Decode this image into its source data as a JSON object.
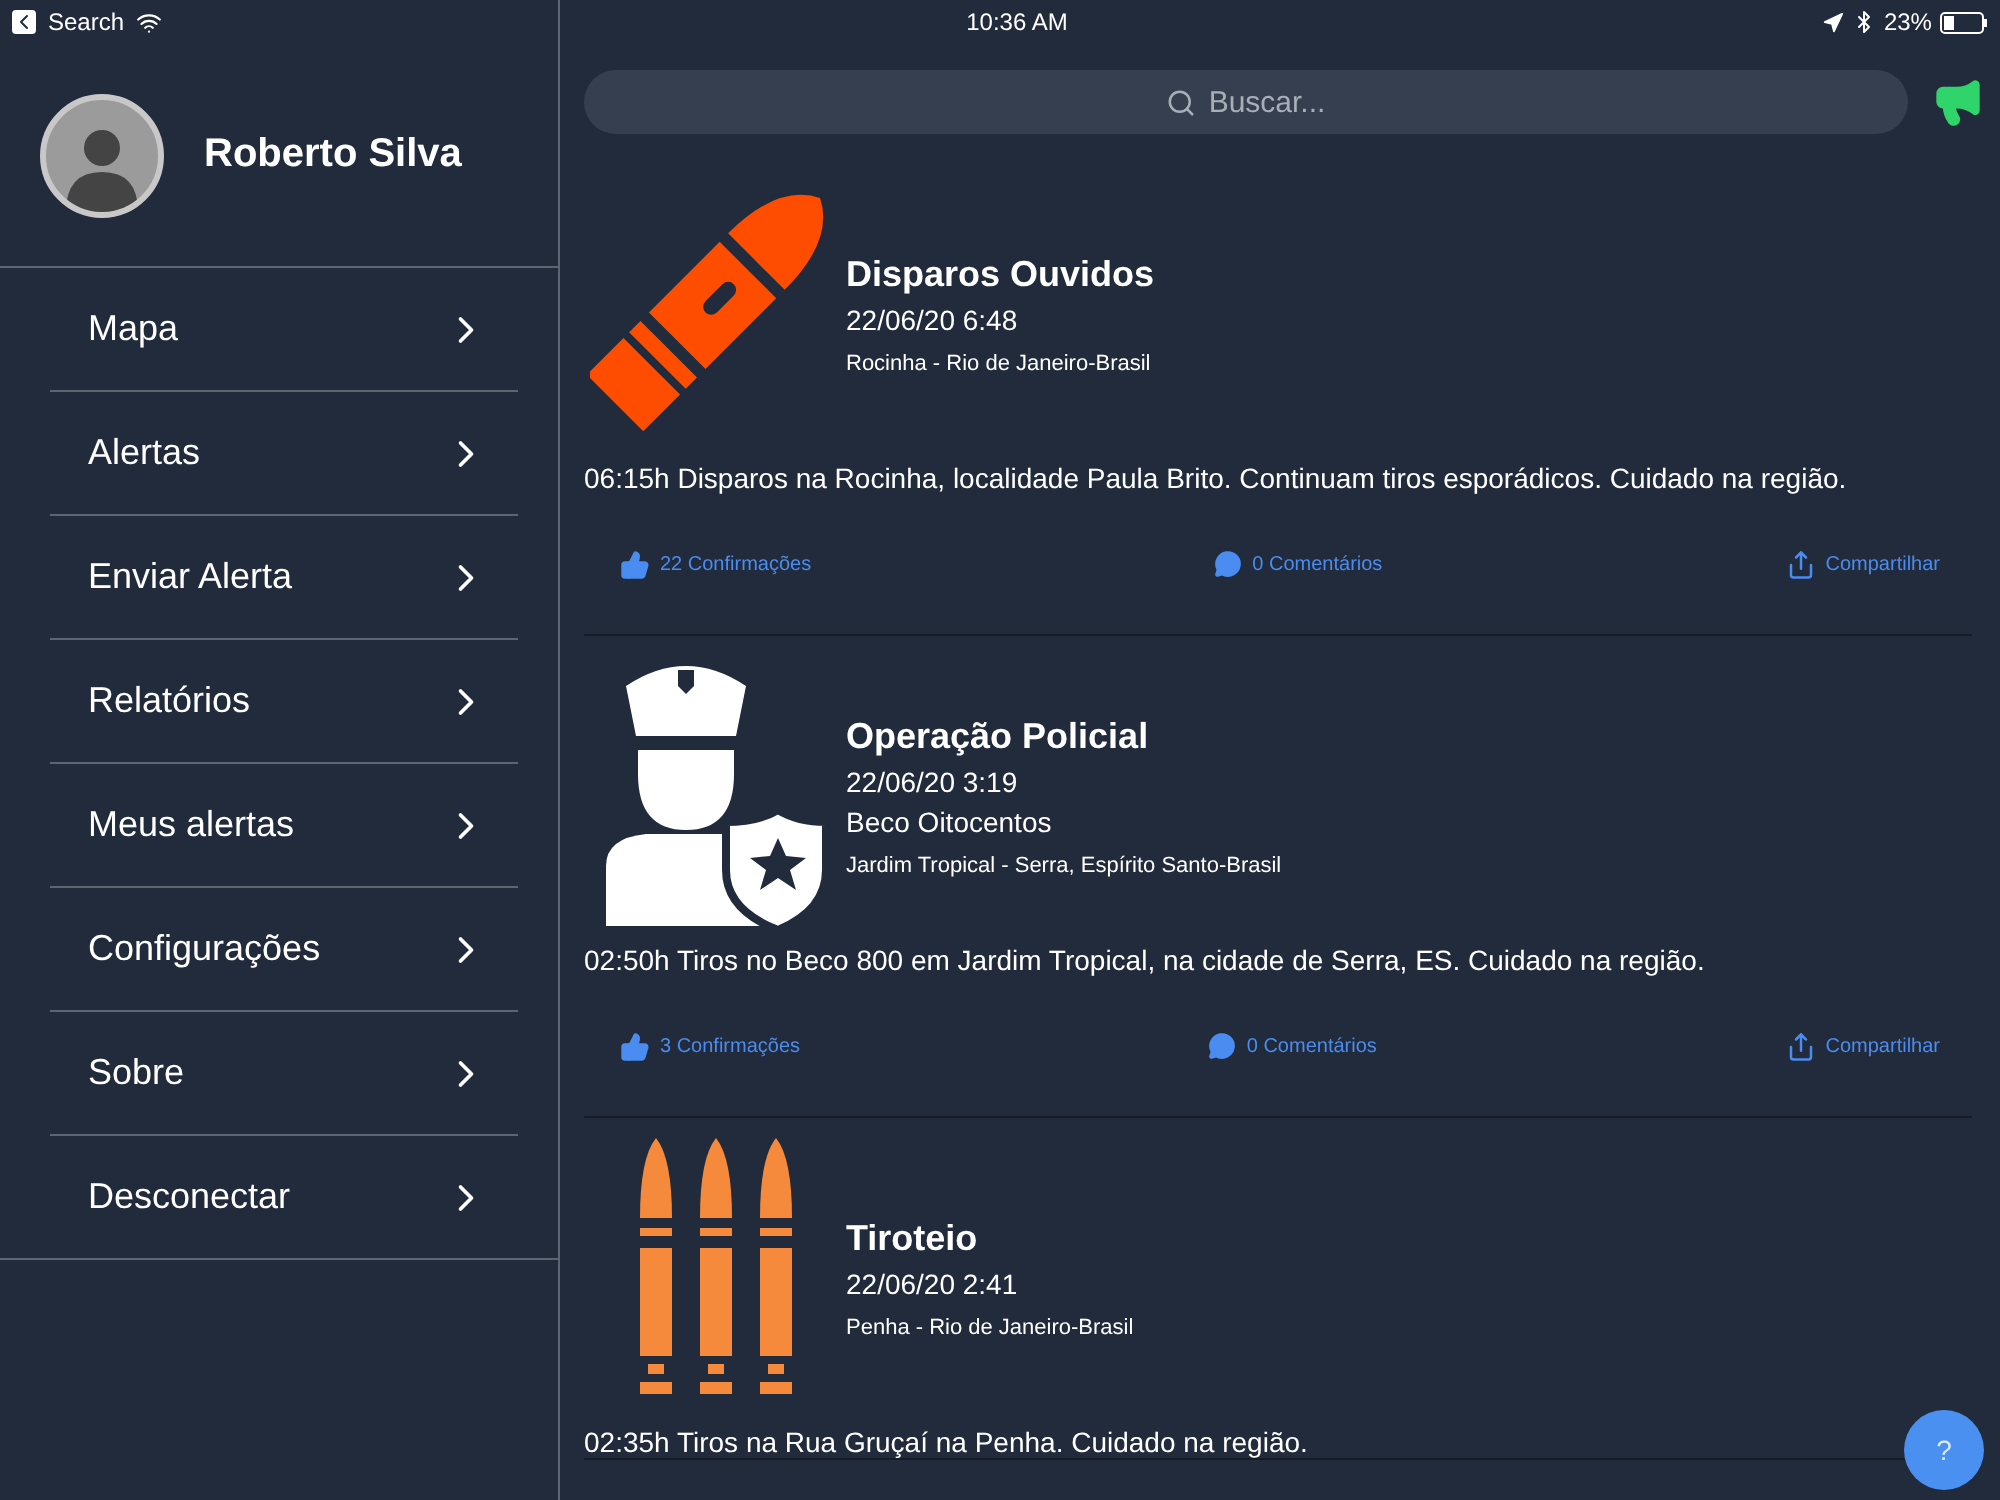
{
  "status_bar": {
    "back_label": "Search",
    "time": "10:36 AM",
    "battery": "23%"
  },
  "profile": {
    "name": "Roberto Silva"
  },
  "menu": [
    {
      "label": "Mapa"
    },
    {
      "label": "Alertas"
    },
    {
      "label": "Enviar Alerta"
    },
    {
      "label": "Relatórios"
    },
    {
      "label": "Meus alertas"
    },
    {
      "label": "Configurações"
    },
    {
      "label": "Sobre"
    },
    {
      "label": "Desconectar"
    }
  ],
  "search": {
    "placeholder": "Buscar..."
  },
  "alerts": [
    {
      "kind": "bullet",
      "title": "Disparos Ouvidos",
      "date": "22/06/20 6:48",
      "location": "Rocinha - Rio de Janeiro-Brasil",
      "description": "06:15h Disparos na Rocinha, localidade Paula Brito. Continuam tiros esporádicos. Cuidado na região.",
      "confirmations": "22 Confirmações",
      "comments": "0 Comentários",
      "share": "Compartilhar"
    },
    {
      "kind": "police",
      "title": "Operação Policial",
      "date": "22/06/20 3:19",
      "place": "Beco Oitocentos",
      "location": "Jardim Tropical - Serra, Espírito Santo-Brasil",
      "description": "02:50h Tiros no Beco 800 em Jardim Tropical, na cidade de Serra, ES. Cuidado na região.",
      "confirmations": "3 Confirmações",
      "comments": "0 Comentários",
      "share": "Compartilhar"
    },
    {
      "kind": "bullets",
      "title": "Tiroteio",
      "date": "22/06/20 2:41",
      "location": "Penha - Rio de Janeiro-Brasil",
      "description": "02:35h Tiros na Rua Gruçaí na Penha. Cuidado na região."
    }
  ],
  "help_button": "?"
}
